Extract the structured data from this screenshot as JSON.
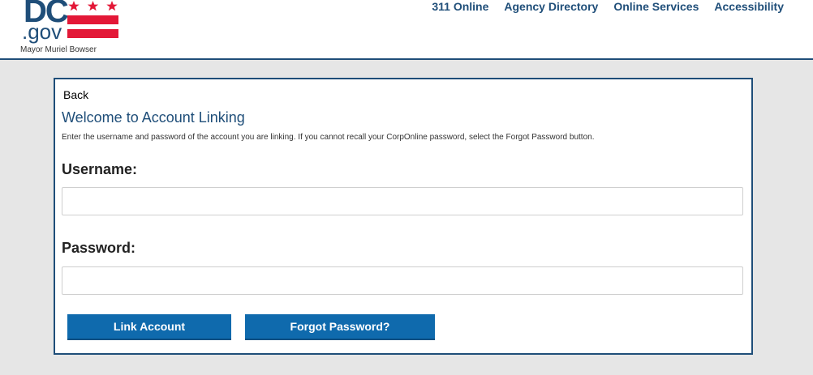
{
  "header": {
    "logo": {
      "dc": "DC",
      "gov": ".gov",
      "tagline": "Mayor Muriel Bowser"
    },
    "nav": [
      {
        "label": "311 Online"
      },
      {
        "label": "Agency Directory"
      },
      {
        "label": "Online Services"
      },
      {
        "label": "Accessibility"
      }
    ]
  },
  "form": {
    "back_label": "Back",
    "title": "Welcome to Account Linking",
    "instructions": "Enter the username and password of the account you are linking. If you cannot recall your CorpOnline password, select the Forgot Password button.",
    "username_label": "Username:",
    "username_value": "",
    "password_label": "Password:",
    "password_value": "",
    "link_button_label": "Link Account",
    "forgot_button_label": "Forgot Password?"
  },
  "colors": {
    "brand_navy": "#1f4e79",
    "button_blue": "#0f6aad",
    "flag_red": "#e31837",
    "page_background": "#e6e6e6"
  }
}
